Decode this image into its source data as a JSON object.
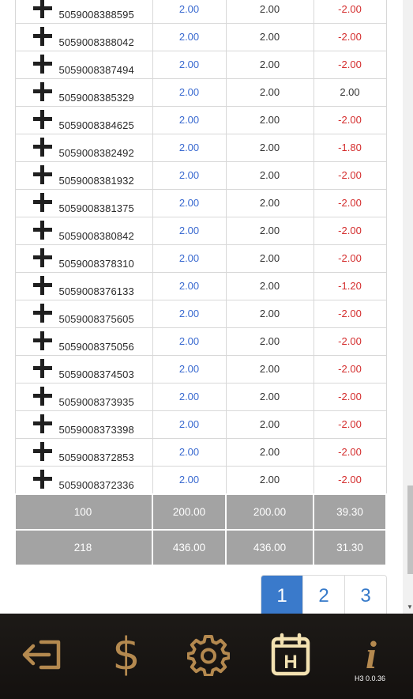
{
  "table": {
    "rows": [
      {
        "id": "5059008388595",
        "a": "2.00",
        "b": "2.00",
        "c": "-2.00"
      },
      {
        "id": "5059008388042",
        "a": "2.00",
        "b": "2.00",
        "c": "-2.00"
      },
      {
        "id": "5059008387494",
        "a": "2.00",
        "b": "2.00",
        "c": "-2.00"
      },
      {
        "id": "5059008385329",
        "a": "2.00",
        "b": "2.00",
        "c": "2.00"
      },
      {
        "id": "5059008384625",
        "a": "2.00",
        "b": "2.00",
        "c": "-2.00"
      },
      {
        "id": "5059008382492",
        "a": "2.00",
        "b": "2.00",
        "c": "-1.80"
      },
      {
        "id": "5059008381932",
        "a": "2.00",
        "b": "2.00",
        "c": "-2.00"
      },
      {
        "id": "5059008381375",
        "a": "2.00",
        "b": "2.00",
        "c": "-2.00"
      },
      {
        "id": "5059008380842",
        "a": "2.00",
        "b": "2.00",
        "c": "-2.00"
      },
      {
        "id": "5059008378310",
        "a": "2.00",
        "b": "2.00",
        "c": "-2.00"
      },
      {
        "id": "5059008376133",
        "a": "2.00",
        "b": "2.00",
        "c": "-1.20"
      },
      {
        "id": "5059008375605",
        "a": "2.00",
        "b": "2.00",
        "c": "-2.00"
      },
      {
        "id": "5059008375056",
        "a": "2.00",
        "b": "2.00",
        "c": "-2.00"
      },
      {
        "id": "5059008374503",
        "a": "2.00",
        "b": "2.00",
        "c": "-2.00"
      },
      {
        "id": "5059008373935",
        "a": "2.00",
        "b": "2.00",
        "c": "-2.00"
      },
      {
        "id": "5059008373398",
        "a": "2.00",
        "b": "2.00",
        "c": "-2.00"
      },
      {
        "id": "5059008372853",
        "a": "2.00",
        "b": "2.00",
        "c": "-2.00"
      },
      {
        "id": "5059008372336",
        "a": "2.00",
        "b": "2.00",
        "c": "-2.00"
      }
    ],
    "totals": [
      {
        "count": "100",
        "a": "200.00",
        "b": "200.00",
        "c": "39.30"
      },
      {
        "count": "218",
        "a": "436.00",
        "b": "436.00",
        "c": "31.30"
      }
    ]
  },
  "pagination": {
    "pages": [
      "1",
      "2",
      "3"
    ],
    "active": "1"
  },
  "nav": {
    "items": [
      {
        "name": "logout-icon"
      },
      {
        "name": "dollar-icon"
      },
      {
        "name": "gear-icon"
      },
      {
        "name": "calendar-h-icon"
      },
      {
        "name": "info-icon"
      }
    ],
    "version": "H3 0.0.36",
    "dollar_glyph": "$",
    "info_glyph": "i",
    "calendar_letter": "H"
  },
  "colors": {
    "accent": "#b4894f",
    "active_page": "#3a7acb",
    "negative": "#d42d2d",
    "value_blue": "#3a6ad0",
    "total_bg": "#a3a3a3"
  }
}
